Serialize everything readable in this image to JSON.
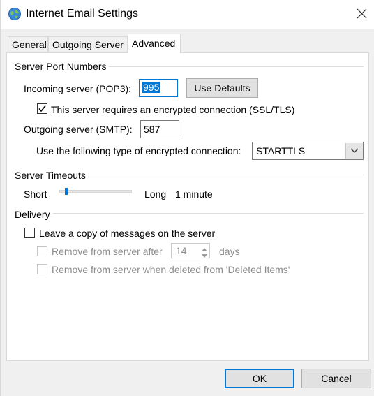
{
  "window": {
    "title": "Internet Email Settings",
    "icon": "globe-icon",
    "close_icon": "close-icon"
  },
  "tabs": [
    {
      "label": "General"
    },
    {
      "label": "Outgoing Server"
    },
    {
      "label": "Advanced",
      "active": true
    }
  ],
  "server_ports": {
    "group_label": "Server Port Numbers",
    "incoming_label": "Incoming server (POP3):",
    "incoming_value": "995",
    "use_defaults_label": "Use Defaults",
    "ssl_checkbox_label": "This server requires an encrypted connection (SSL/TLS)",
    "ssl_checked": true,
    "outgoing_label": "Outgoing server (SMTP):",
    "outgoing_value": "587",
    "encryption_label": "Use the following type of encrypted connection:",
    "encryption_value": "STARTTLS"
  },
  "timeouts": {
    "group_label": "Server Timeouts",
    "short_label": "Short",
    "long_label": "Long",
    "value_label": "1 minute",
    "slider_fraction": 0.1
  },
  "delivery": {
    "group_label": "Delivery",
    "leave_copy_label": "Leave a copy of messages on the server",
    "leave_copy_checked": false,
    "remove_after_label": "Remove from server after",
    "remove_after_days": "14",
    "days_label": "days",
    "remove_deleted_label": "Remove from server when deleted from 'Deleted Items'"
  },
  "footer": {
    "ok_label": "OK",
    "cancel_label": "Cancel"
  },
  "colors": {
    "accent": "#0078d7",
    "dialog_bg": "#f0f0f0",
    "panel_bg": "#ffffff"
  }
}
